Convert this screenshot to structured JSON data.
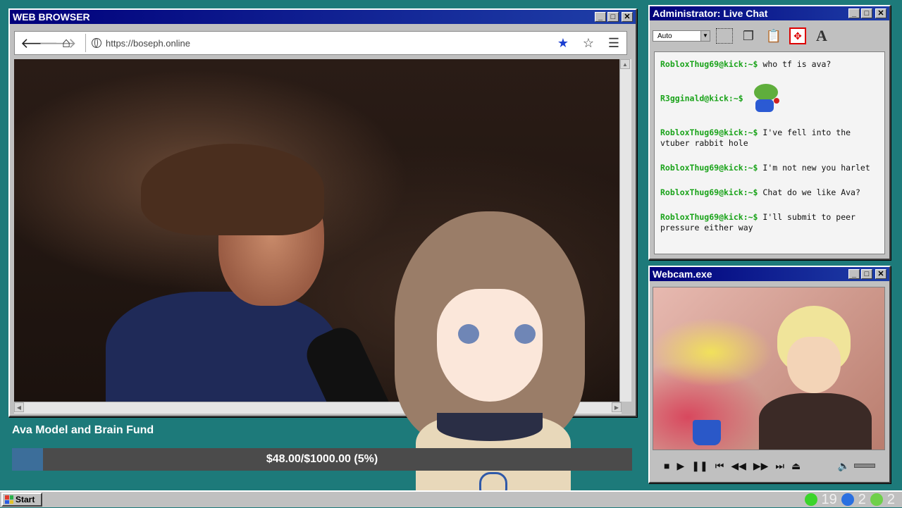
{
  "browser": {
    "title": "WEB BROWSER",
    "url": "https://boseph.online",
    "controls": {
      "min": "_",
      "max": "□",
      "close": "✕"
    }
  },
  "chat": {
    "title": "Administrator: Live Chat",
    "zoom_select": "Auto",
    "messages": [
      {
        "user": "RobloxThug69@kick:~$",
        "text": "who tf is ava?"
      },
      {
        "user": "R3gginald@kick:~$",
        "text": "",
        "emote": "pepe-emote"
      },
      {
        "user": "RobloxThug69@kick:~$",
        "text": "I've fell into the vtuber rabbit hole"
      },
      {
        "user": "RobloxThug69@kick:~$",
        "text": "I'm not new you harlet"
      },
      {
        "user": "RobloxThug69@kick:~$",
        "text": "Chat do we like Ava?"
      },
      {
        "user": "RobloxThug69@kick:~$",
        "text": "I'll submit to peer pressure either way"
      }
    ]
  },
  "webcam": {
    "title": "Webcam.exe"
  },
  "fund": {
    "title": "Ava Model and Brain Fund",
    "progress_text": "$48.00/$1000.00 (5%)",
    "progress_fraction": 0.05
  },
  "taskbar": {
    "start_label": "Start",
    "tray": [
      {
        "icon": "kick-icon",
        "value": "19",
        "color": "#3bd42b"
      },
      {
        "icon": "moon-icon",
        "value": "2",
        "color": "#2a70e0"
      },
      {
        "icon": "play-icon",
        "value": "2",
        "color": "#6fd04a"
      }
    ]
  },
  "colors": {
    "desktop": "#1d7a7a",
    "titlebar": "#00007b",
    "chat_user": "#1aa31a",
    "fund_fill": "#3c6e9a"
  }
}
